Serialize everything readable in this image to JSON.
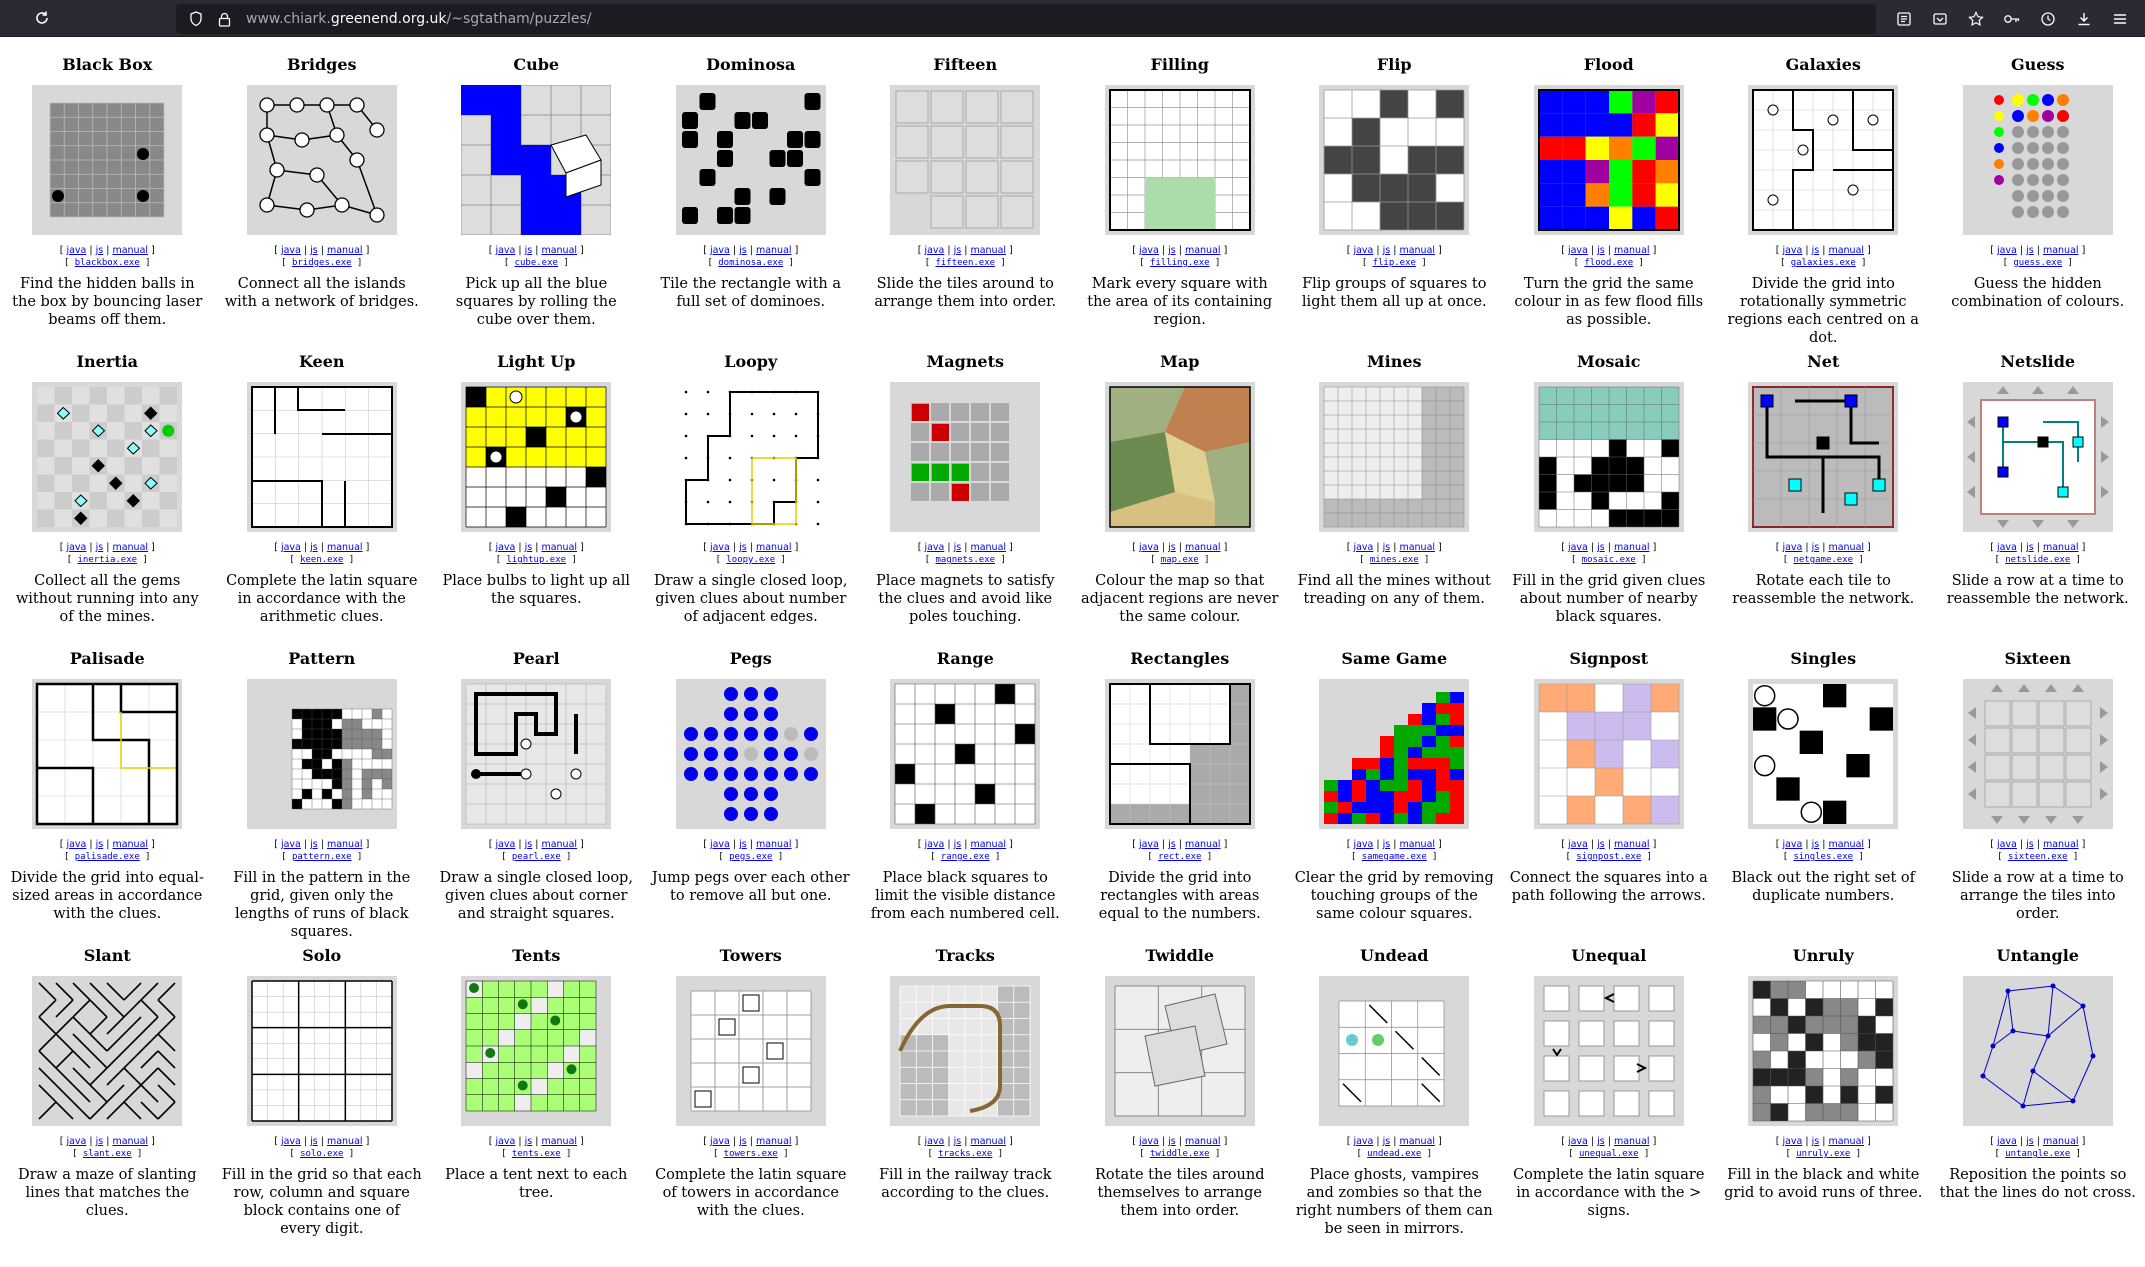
{
  "browser": {
    "url_prefix": "www.chiark.",
    "url_host": "greenend.org.uk",
    "url_path": "/~sgtatham/puzzles/"
  },
  "link_labels": {
    "java": "java",
    "js": "js",
    "manual": "manual"
  },
  "puzzles": [
    {
      "title": "Black Box",
      "exe": "blackbox.exe",
      "desc": "Find the hidden balls in the box by bouncing laser beams off them.",
      "kind": "blackbox"
    },
    {
      "title": "Bridges",
      "exe": "bridges.exe",
      "desc": "Connect all the islands with a network of bridges.",
      "kind": "bridges"
    },
    {
      "title": "Cube",
      "exe": "cube.exe",
      "desc": "Pick up all the blue squares by rolling the cube over them.",
      "kind": "cube"
    },
    {
      "title": "Dominosa",
      "exe": "dominosa.exe",
      "desc": "Tile the rectangle with a full set of dominoes.",
      "kind": "dominosa"
    },
    {
      "title": "Fifteen",
      "exe": "fifteen.exe",
      "desc": "Slide the tiles around to arrange them into order.",
      "kind": "fifteen"
    },
    {
      "title": "Filling",
      "exe": "filling.exe",
      "desc": "Mark every square with the area of its containing region.",
      "kind": "filling"
    },
    {
      "title": "Flip",
      "exe": "flip.exe",
      "desc": "Flip groups of squares to light them all up at once.",
      "kind": "flip"
    },
    {
      "title": "Flood",
      "exe": "flood.exe",
      "desc": "Turn the grid the same colour in as few flood fills as possible.",
      "kind": "flood"
    },
    {
      "title": "Galaxies",
      "exe": "galaxies.exe",
      "desc": "Divide the grid into rotationally symmetric regions each centred on a dot.",
      "kind": "galaxies"
    },
    {
      "title": "Guess",
      "exe": "guess.exe",
      "desc": "Guess the hidden combination of colours.",
      "kind": "guess"
    },
    {
      "title": "Inertia",
      "exe": "inertia.exe",
      "desc": "Collect all the gems without running into any of the mines.",
      "kind": "inertia"
    },
    {
      "title": "Keen",
      "exe": "keen.exe",
      "desc": "Complete the latin square in accordance with the arithmetic clues.",
      "kind": "keen"
    },
    {
      "title": "Light Up",
      "exe": "lightup.exe",
      "desc": "Place bulbs to light up all the squares.",
      "kind": "lightup"
    },
    {
      "title": "Loopy",
      "exe": "loopy.exe",
      "desc": "Draw a single closed loop, given clues about number of adjacent edges.",
      "kind": "loopy"
    },
    {
      "title": "Magnets",
      "exe": "magnets.exe",
      "desc": "Place magnets to satisfy the clues and avoid like poles touching.",
      "kind": "magnets"
    },
    {
      "title": "Map",
      "exe": "map.exe",
      "desc": "Colour the map so that adjacent regions are never the same colour.",
      "kind": "map"
    },
    {
      "title": "Mines",
      "exe": "mines.exe",
      "desc": "Find all the mines without treading on any of them.",
      "kind": "mines"
    },
    {
      "title": "Mosaic",
      "exe": "mosaic.exe",
      "desc": "Fill in the grid given clues about number of nearby black squares.",
      "kind": "mosaic"
    },
    {
      "title": "Net",
      "exe": "netgame.exe",
      "desc": "Rotate each tile to reassemble the network.",
      "kind": "net"
    },
    {
      "title": "Netslide",
      "exe": "netslide.exe",
      "desc": "Slide a row at a time to reassemble the network.",
      "kind": "netslide"
    },
    {
      "title": "Palisade",
      "exe": "palisade.exe",
      "desc": "Divide the grid into equal-sized areas in accordance with the clues.",
      "kind": "palisade"
    },
    {
      "title": "Pattern",
      "exe": "pattern.exe",
      "desc": "Fill in the pattern in the grid, given only the lengths of runs of black squares.",
      "kind": "pattern"
    },
    {
      "title": "Pearl",
      "exe": "pearl.exe",
      "desc": "Draw a single closed loop, given clues about corner and straight squares.",
      "kind": "pearl"
    },
    {
      "title": "Pegs",
      "exe": "pegs.exe",
      "desc": "Jump pegs over each other to remove all but one.",
      "kind": "pegs"
    },
    {
      "title": "Range",
      "exe": "range.exe",
      "desc": "Place black squares to limit the visible distance from each numbered cell.",
      "kind": "range"
    },
    {
      "title": "Rectangles",
      "exe": "rect.exe",
      "desc": "Divide the grid into rectangles with areas equal to the numbers.",
      "kind": "rect"
    },
    {
      "title": "Same Game",
      "exe": "samegame.exe",
      "desc": "Clear the grid by removing touching groups of the same colour squares.",
      "kind": "samegame"
    },
    {
      "title": "Signpost",
      "exe": "signpost.exe",
      "desc": "Connect the squares into a path following the arrows.",
      "kind": "signpost"
    },
    {
      "title": "Singles",
      "exe": "singles.exe",
      "desc": "Black out the right set of duplicate numbers.",
      "kind": "singles"
    },
    {
      "title": "Sixteen",
      "exe": "sixteen.exe",
      "desc": "Slide a row at a time to arrange the tiles into order.",
      "kind": "sixteen"
    },
    {
      "title": "Slant",
      "exe": "slant.exe",
      "desc": "Draw a maze of slanting lines that matches the clues.",
      "kind": "slant"
    },
    {
      "title": "Solo",
      "exe": "solo.exe",
      "desc": "Fill in the grid so that each row, column and square block contains one of every digit.",
      "kind": "solo"
    },
    {
      "title": "Tents",
      "exe": "tents.exe",
      "desc": "Place a tent next to each tree.",
      "kind": "tents"
    },
    {
      "title": "Towers",
      "exe": "towers.exe",
      "desc": "Complete the latin square of towers in accordance with the clues.",
      "kind": "towers"
    },
    {
      "title": "Tracks",
      "exe": "tracks.exe",
      "desc": "Fill in the railway track according to the clues.",
      "kind": "tracks"
    },
    {
      "title": "Twiddle",
      "exe": "twiddle.exe",
      "desc": "Rotate the tiles around themselves to arrange them into order.",
      "kind": "twiddle"
    },
    {
      "title": "Undead",
      "exe": "undead.exe",
      "desc": "Place ghosts, vampires and zombies so that the right numbers of them can be seen in mirrors.",
      "kind": "undead"
    },
    {
      "title": "Unequal",
      "exe": "unequal.exe",
      "desc": "Complete the latin square in accordance with the > signs.",
      "kind": "unequal"
    },
    {
      "title": "Unruly",
      "exe": "unruly.exe",
      "desc": "Fill in the black and white grid to avoid runs of three.",
      "kind": "unruly"
    },
    {
      "title": "Untangle",
      "exe": "untangle.exe",
      "desc": "Reposition the points so that the lines do not cross.",
      "kind": "untangle"
    }
  ]
}
